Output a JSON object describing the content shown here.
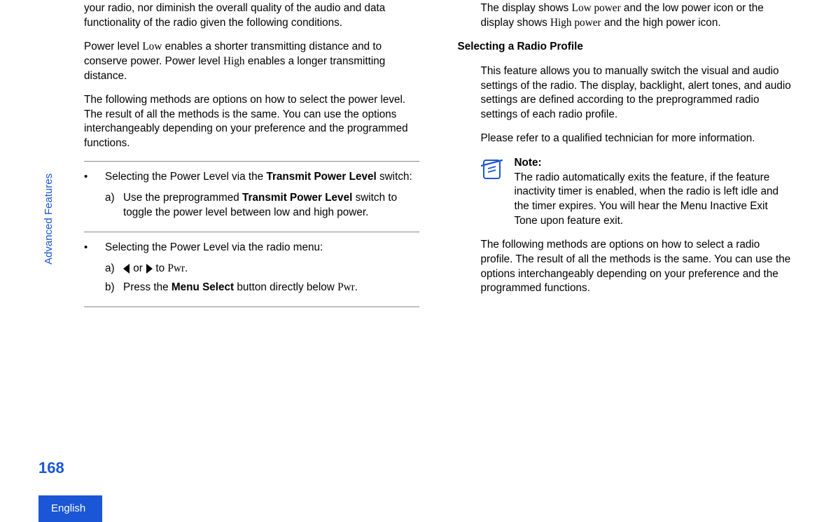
{
  "sideLabel": "Advanced Features",
  "pageNumber": "168",
  "language": "English",
  "left": {
    "p1": "your radio, nor diminish the overall quality of the audio and data functionality of the radio given the following conditions.",
    "p2_a": "Power level ",
    "p2_low": "Low",
    "p2_b": " enables a shorter transmitting distance and to conserve power. Power level ",
    "p2_high": "High",
    "p2_c": " enables a longer transmitting distance.",
    "p3": "The following methods are options on how to select the power level. The result of all the methods is the same. You can use the options interchangeably depending on your preference and the programmed functions.",
    "bullet1_a": "Selecting the Power Level via the ",
    "bullet1_b": "Transmit Power Level",
    "bullet1_c": " switch:",
    "b1_a_label": "a)",
    "b1_a_text_a": "Use the preprogrammed ",
    "b1_a_text_b": "Transmit Power Level",
    "b1_a_text_c": " switch to toggle the power level between low and high power.",
    "bullet2": "Selecting the Power Level via the radio menu:",
    "b2_a_label": "a)",
    "b2_a_or": " or ",
    "b2_a_to": " to ",
    "b2_a_pwr": "Pwr",
    "b2_a_end": ".",
    "b2_b_label": "b)",
    "b2_b_text_a": "Press the ",
    "b2_b_text_b": "Menu Select",
    "b2_b_text_c": " button directly below ",
    "b2_b_pwr": "Pwr",
    "b2_b_end": "."
  },
  "right": {
    "p1_a": "The display shows ",
    "p1_low": "Low power",
    "p1_b": " and the low power icon or the display shows ",
    "p1_high": "High power",
    "p1_c": " and the high power icon.",
    "h1": "Selecting a Radio Profile",
    "p2": "This feature allows you to manually switch the visual and audio settings of the radio. The display, backlight, alert tones, and audio settings are defined according to the preprogrammed radio settings of each radio profile.",
    "p3": "Please refer to a qualified technician for more information.",
    "noteLabel": "Note:",
    "noteText": "The radio automatically exits the feature, if the feature inactivity timer is enabled, when the radio is left idle and the timer expires. You will hear the Menu Inactive Exit Tone upon feature exit.",
    "p4": "The following methods are options on how to select a radio profile. The result of all the methods is the same. You can use the options interchangeably depending on your preference and the programmed functions."
  }
}
